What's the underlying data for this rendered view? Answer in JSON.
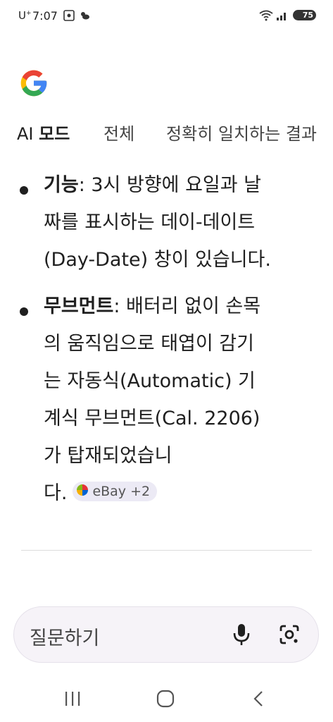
{
  "status_bar": {
    "carrier": "U",
    "carrier_sup": "+",
    "time": "7:07",
    "battery": "75"
  },
  "logo": {
    "name": "google-g-logo",
    "colors": [
      "#4285F4",
      "#EA4335",
      "#FBBC05",
      "#34A853"
    ]
  },
  "tabs": [
    {
      "label_prefix": "AI",
      "label_bold": "모드"
    },
    {
      "label": "전체"
    },
    {
      "label": "정확히 일치하는 결과"
    }
  ],
  "content": {
    "items": [
      {
        "term": "기능",
        "lines": [
          ": 3시 방향에 요일과 날",
          "짜를 표시하는 데이-데이트",
          "(Day-Date) 창이 있습니다."
        ]
      },
      {
        "term": "무브먼트",
        "lines": [
          ": 배터리 없이 손목",
          "의 움직임으로 태엽이 감기",
          "는 자동식(Automatic) 기",
          "계식 무브먼트(Cal. 2206)",
          "가 탑재되었습니",
          "다."
        ],
        "source_chip": "eBay +2"
      }
    ]
  },
  "search": {
    "placeholder": "질문하기"
  },
  "colors": {
    "accent_bg": "#f6f3f8",
    "chip_bg": "#eceaf5",
    "text": "#1f1f1f"
  }
}
